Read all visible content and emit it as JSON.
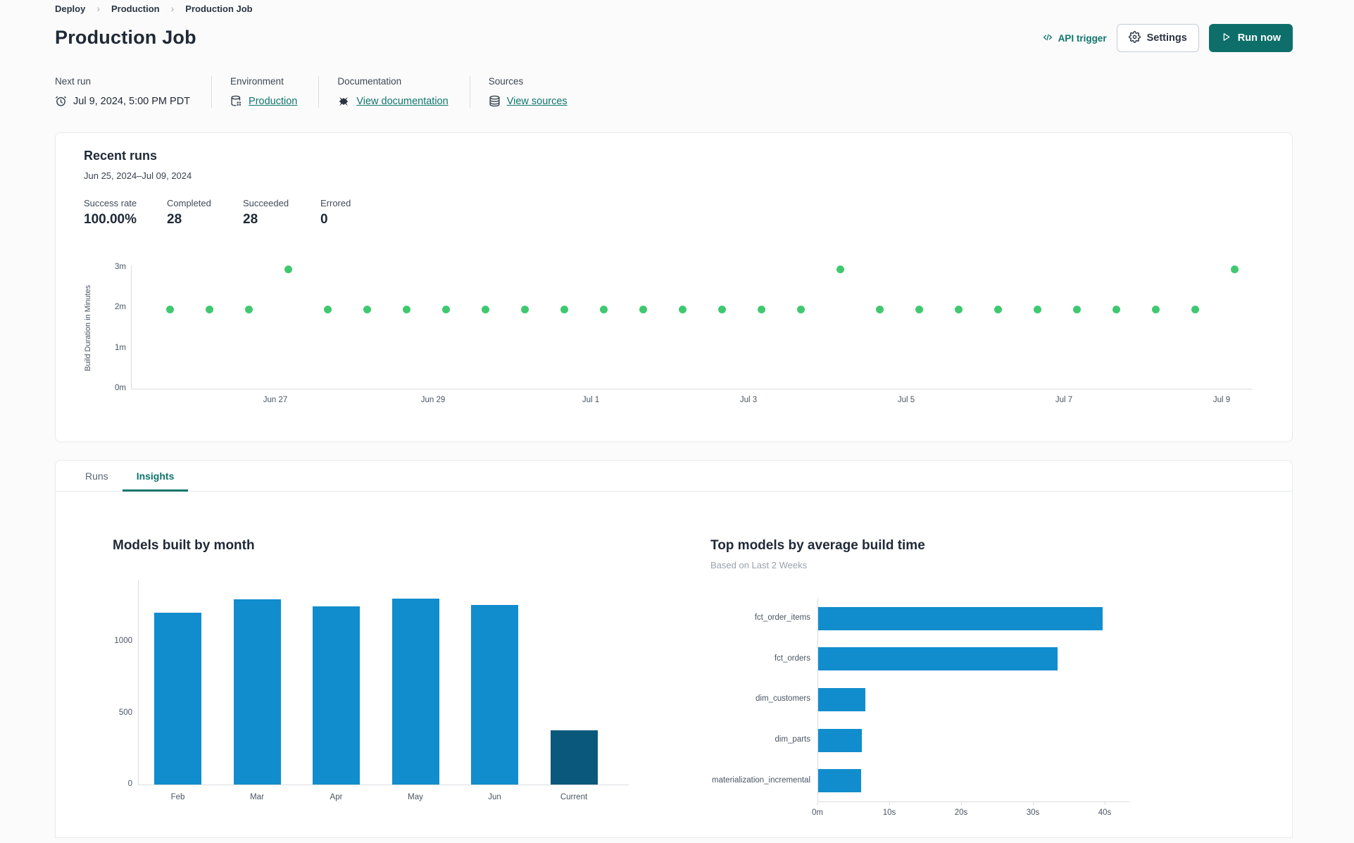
{
  "colors": {
    "accent_teal": "#0e6f6a",
    "link_teal": "#0f756d",
    "bar_blue": "#118dcd",
    "bar_highlight": "#0a597c",
    "dot_green": "#3fc96f",
    "page_bg": "#fbfbfb",
    "card_border": "#e7e9ec"
  },
  "breadcrumb": {
    "items": [
      "Deploy",
      "Production",
      "Production Job"
    ],
    "separator": "›"
  },
  "header": {
    "title": "Production Job",
    "api_trigger": {
      "label": "API trigger",
      "icon": "code-brackets-icon"
    },
    "settings": {
      "label": "Settings",
      "icon": "gear-icon"
    },
    "run_now": {
      "label": "Run now",
      "icon": "play-icon"
    }
  },
  "meta": {
    "columns": [
      {
        "label": "Next run",
        "value": "Jul 9, 2024, 5:00 PM PDT",
        "icon": "alarm-clock-icon",
        "is_link": false
      },
      {
        "label": "Environment",
        "value": "Production",
        "icon": "environment-database-icon",
        "is_link": true
      },
      {
        "label": "Documentation",
        "value": "View documentation",
        "icon": "dbt-docs-icon",
        "is_link": true
      },
      {
        "label": "Sources",
        "value": "View sources",
        "icon": "database-icon",
        "is_link": true
      }
    ]
  },
  "recent_runs": {
    "title": "Recent runs",
    "date_range": "Jun 25, 2024–Jul 09, 2024",
    "stats": [
      {
        "label": "Success rate",
        "value": "100.00%"
      },
      {
        "label": "Completed",
        "value": "28"
      },
      {
        "label": "Succeeded",
        "value": "28"
      },
      {
        "label": "Errored",
        "value": "0"
      }
    ]
  },
  "tabs": [
    {
      "label": "Runs",
      "active": false
    },
    {
      "label": "Insights",
      "active": true
    }
  ],
  "chart_data": [
    {
      "id": "recent-run-durations",
      "type": "scatter",
      "title": "Recent runs",
      "ylabel": "Build Duration in Minutes",
      "y_ticks": [
        "0m",
        "1m",
        "2m",
        "3m"
      ],
      "x_ticks": [
        "Jun 27",
        "Jun 29",
        "Jul 1",
        "Jul 3",
        "Jul 5",
        "Jul 7",
        "Jul 9"
      ],
      "ylim": [
        0,
        3.2
      ],
      "point_color": "#3fc96f",
      "points_minutes": [
        2,
        2,
        2,
        3,
        2,
        2,
        2,
        2,
        2,
        2,
        2,
        2,
        2,
        2,
        2,
        2,
        2,
        3,
        2,
        2,
        2,
        2,
        2,
        2,
        2,
        2,
        2,
        3
      ]
    },
    {
      "id": "models-built-by-month",
      "type": "bar",
      "title": "Models built by month",
      "categories": [
        "Feb",
        "Mar",
        "Apr",
        "May",
        "Jun",
        "Current"
      ],
      "values": [
        1205,
        1295,
        1250,
        1300,
        1255,
        380
      ],
      "bar_colors": [
        "#118dcd",
        "#118dcd",
        "#118dcd",
        "#118dcd",
        "#118dcd",
        "#0a597c"
      ],
      "xlabel": "",
      "ylabel": "",
      "y_ticks": [
        0,
        500,
        1000
      ],
      "ylim": [
        0,
        1430
      ],
      "grid": false,
      "legend": "none"
    },
    {
      "id": "top-models-by-average-build-time",
      "type": "bar-horizontal",
      "title": "Top models by average build time",
      "subtitle": "Based on Last 2 Weeks",
      "categories": [
        "fct_order_items",
        "fct_orders",
        "dim_customers",
        "dim_parts",
        "materialization_incremental"
      ],
      "values_seconds": [
        39.6,
        33.3,
        6.6,
        6.1,
        6.0
      ],
      "x_ticks": [
        "0m",
        "10s",
        "20s",
        "30s",
        "40s"
      ],
      "x_tick_seconds": [
        0,
        10,
        20,
        30,
        40
      ],
      "xlim": [
        0,
        43
      ],
      "bar_color": "#118dcd",
      "grid": false,
      "legend": "none"
    }
  ]
}
